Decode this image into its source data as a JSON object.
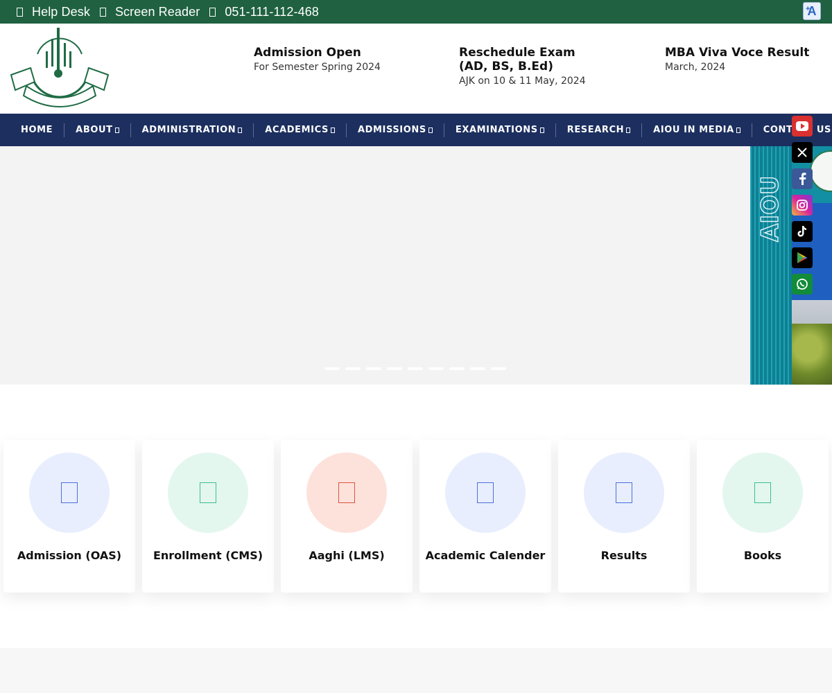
{
  "topbar": {
    "items": [
      {
        "label": "Help Desk",
        "icon": "headset-icon"
      },
      {
        "label": "Screen Reader",
        "icon": "screen-reader-icon"
      },
      {
        "label": "051-111-112-468",
        "icon": "phone-icon"
      }
    ],
    "a11y_label": "A",
    "a11y_small": "+"
  },
  "header": {
    "news": [
      {
        "title": "Admission Open",
        "subtitle": "For Semester Spring 2024"
      },
      {
        "title": "Reschedule Exam",
        "title2": "(AD, BS, B.Ed)",
        "subtitle": "AJK on 10 & 11 May, 2024"
      },
      {
        "title": "MBA Viva Voce Result",
        "subtitle": "March, 2024"
      }
    ]
  },
  "nav": {
    "items": [
      {
        "label": "HOME",
        "has_caret": false
      },
      {
        "label": "ABOUT",
        "has_caret": true
      },
      {
        "label": "ADMINISTRATION",
        "has_caret": true
      },
      {
        "label": "ACADEMICS",
        "has_caret": true
      },
      {
        "label": "ADMISSIONS",
        "has_caret": true
      },
      {
        "label": "EXAMINATIONS",
        "has_caret": true
      },
      {
        "label": "RESEARCH",
        "has_caret": true
      },
      {
        "label": "AIOU IN MEDIA",
        "has_caret": true
      },
      {
        "label": "CONTACT US",
        "has_caret": false
      }
    ]
  },
  "social": [
    {
      "name": "youtube-icon",
      "color": "#d93030"
    },
    {
      "name": "x-icon",
      "color": "#000000"
    },
    {
      "name": "facebook-icon",
      "color": "#3b5998"
    },
    {
      "name": "instagram-icon",
      "color": "#d6249f"
    },
    {
      "name": "tiktok-icon",
      "color": "#000000"
    },
    {
      "name": "google-play-icon",
      "color": "#000000"
    },
    {
      "name": "whatsapp-icon",
      "color": "#128c3a"
    }
  ],
  "hero": {
    "slide_count": 9,
    "banner_text": "AIOU"
  },
  "quick_links": [
    {
      "label": "Admission (OAS)",
      "circle": "#e8eefe",
      "icon_color": "#4a6fd8",
      "icon": "admission-icon"
    },
    {
      "label": "Enrollment (CMS)",
      "circle": "#e3f7ef",
      "icon_color": "#3cbf86",
      "icon": "enrollment-icon"
    },
    {
      "label": "Aaghi (LMS)",
      "circle": "#fde2dc",
      "icon_color": "#e0533a",
      "icon": "lms-icon"
    },
    {
      "label": "Academic Calender",
      "circle": "#e8eefe",
      "icon_color": "#4a6fd8",
      "icon": "calendar-icon"
    },
    {
      "label": "Results",
      "circle": "#e8eefe",
      "icon_color": "#4a6fd8",
      "icon": "results-icon"
    },
    {
      "label": "Books",
      "circle": "#e3f7ef",
      "icon_color": "#3cbf86",
      "icon": "books-icon"
    }
  ]
}
